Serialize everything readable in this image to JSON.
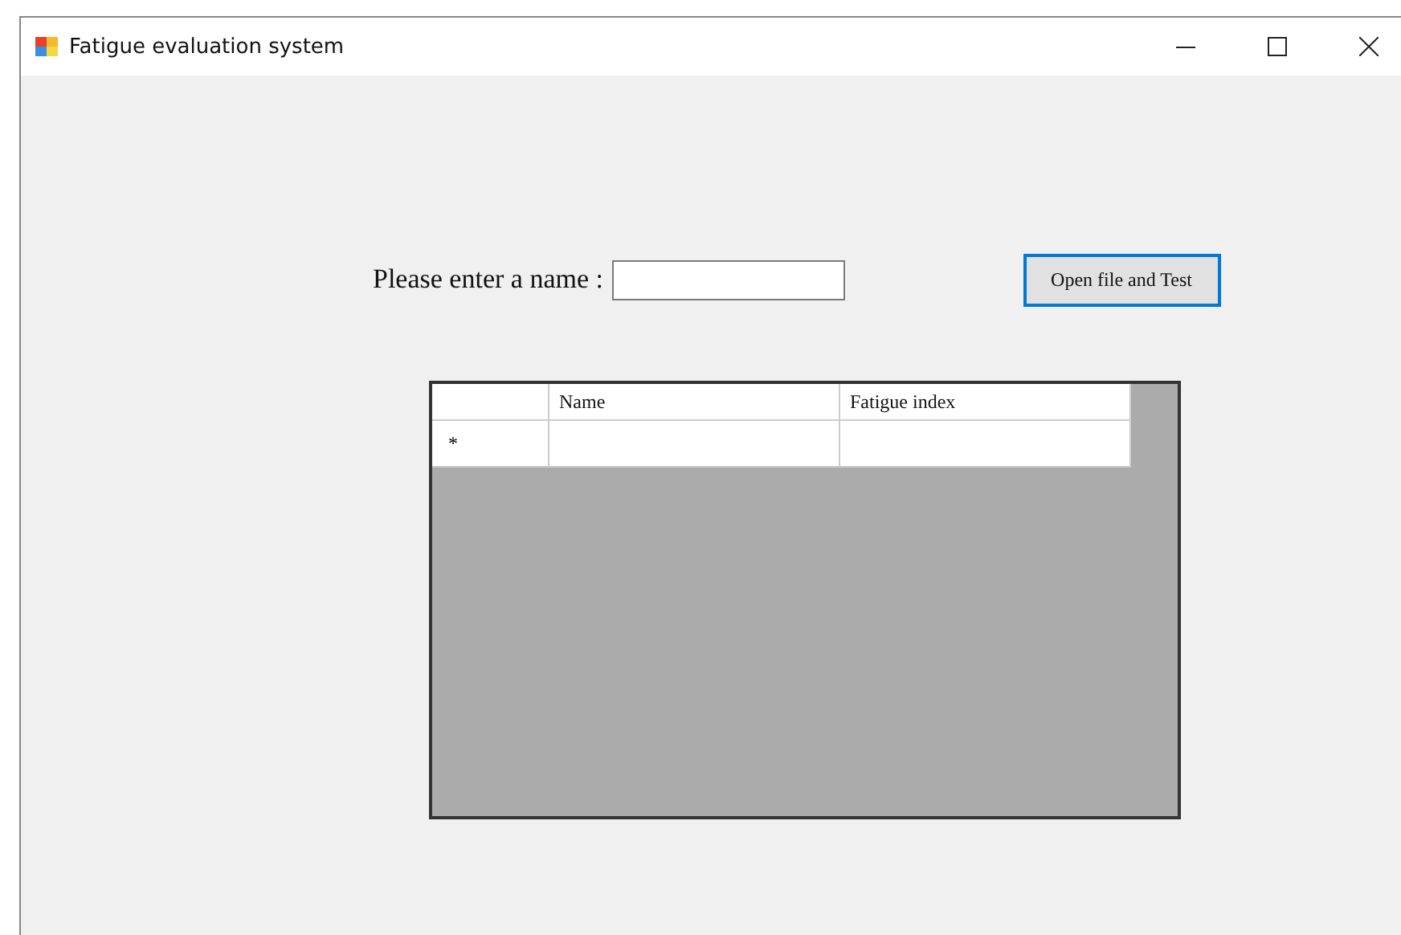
{
  "window": {
    "title": "Fatigue evaluation system"
  },
  "name_field": {
    "label": "Please enter a name :"
  },
  "open_button": {
    "label": "Open file and Test",
    "focused": true
  },
  "grid": {
    "columns": [
      "Name",
      "Fatigue index"
    ],
    "rows": [
      {
        "marker": "*",
        "cells": [
          "",
          ""
        ]
      }
    ]
  }
}
